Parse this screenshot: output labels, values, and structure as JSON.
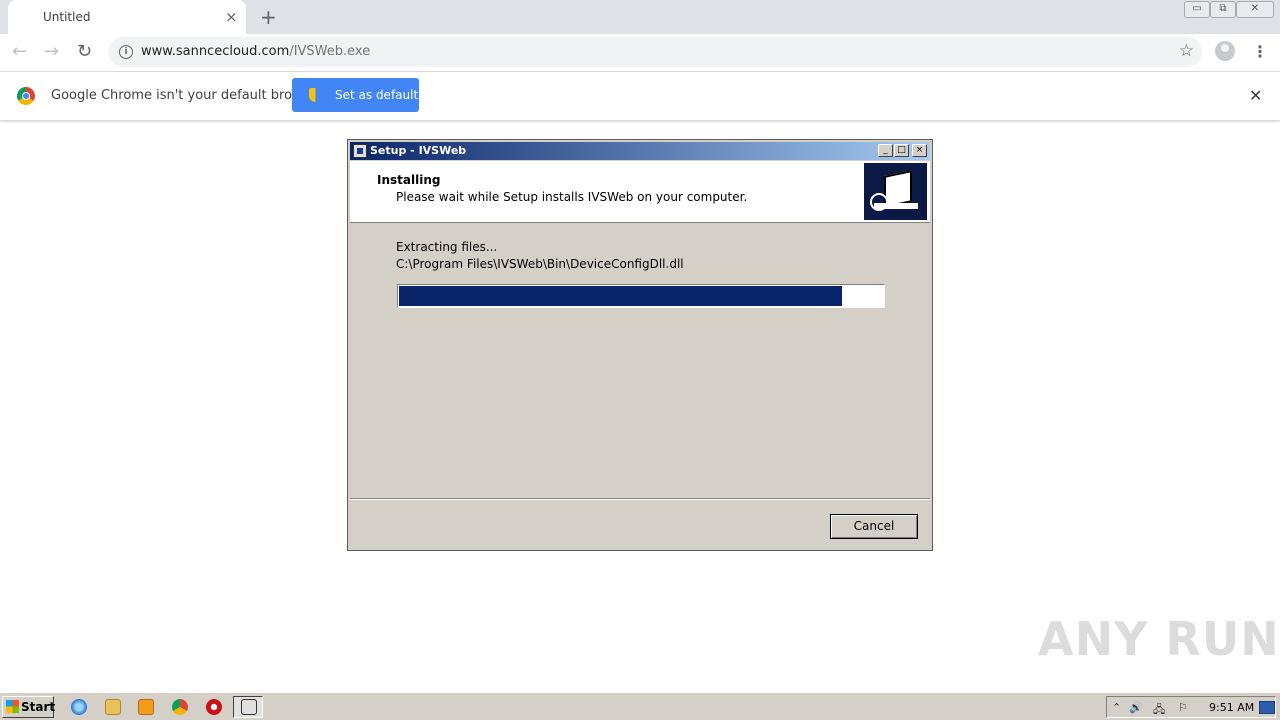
{
  "browser": {
    "tab_title": "Untitled",
    "tab_close_icon": "×",
    "new_tab_icon": "+",
    "url_host": "www.sanncecloud.com",
    "url_path": "/IVSWeb.exe",
    "info_icon": "i",
    "bookmark_icon": "☆",
    "menu_icon": "⋮",
    "back_icon": "←",
    "forward_icon": "→",
    "reload_icon": "↻",
    "window_controls": [
      "▭",
      "⧉",
      "✕"
    ]
  },
  "infobar": {
    "message": "Google Chrome isn't your default browser",
    "button_label": "Set as default",
    "close_icon": "✕"
  },
  "dialog": {
    "title": "Setup - IVSWeb",
    "title_buttons": [
      "_",
      "□",
      "×"
    ],
    "heading": "Installing",
    "subheading": "Please wait while Setup installs IVSWeb on your computer.",
    "status_line1": "Extracting files...",
    "status_line2": "C:\\Program Files\\IVSWeb\\Bin\\DeviceConfigDll.dll",
    "progress_fraction": 0.915,
    "cancel_label": "Cancel",
    "colors": {
      "title_gradient_start": "#0a246a",
      "progress": "#0a246a",
      "face": "#d4d0c8"
    }
  },
  "watermark": "ANY RUN",
  "taskbar": {
    "start_label": "Start",
    "tray_icons": [
      "⌃",
      "🔊",
      "🖧",
      "⚐"
    ],
    "clock": "9:51 AM"
  }
}
